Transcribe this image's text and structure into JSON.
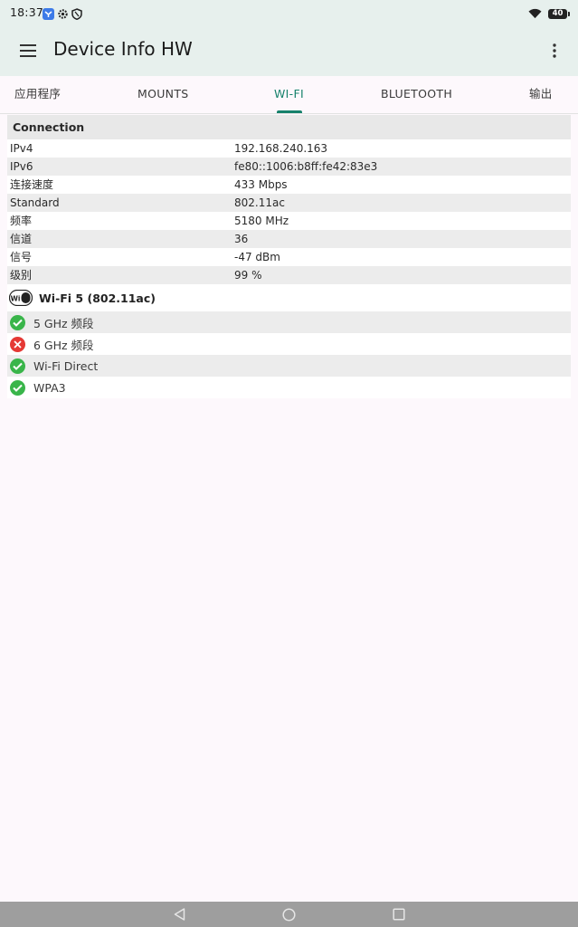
{
  "status_bar": {
    "time": "18:37",
    "battery": "40"
  },
  "app_bar": {
    "title": "Device Info HW"
  },
  "tabs": [
    {
      "label": "应用程序",
      "active": false
    },
    {
      "label": "MOUNTS",
      "active": false
    },
    {
      "label": "WI-FI",
      "active": true
    },
    {
      "label": "BLUETOOTH",
      "active": false
    },
    {
      "label": "输出",
      "active": false
    }
  ],
  "connection": {
    "header": "Connection",
    "rows": [
      {
        "key": "IPv4",
        "value": "192.168.240.163"
      },
      {
        "key": "IPv6",
        "value": "fe80::1006:b8ff:fe42:83e3"
      },
      {
        "key": "连接速度",
        "value": "433 Mbps"
      },
      {
        "key": "Standard",
        "value": "802.11ac"
      },
      {
        "key": "频率",
        "value": "5180 MHz"
      },
      {
        "key": "信道",
        "value": "36"
      },
      {
        "key": "信号",
        "value": "-47 dBm"
      },
      {
        "key": "级别",
        "value": "99 %"
      }
    ]
  },
  "wifi_standard": {
    "logo_text": "Wi Fi",
    "label": "Wi-Fi 5 (802.11ac)"
  },
  "features": [
    {
      "label": "5 GHz 频段",
      "supported": true
    },
    {
      "label": "6 GHz 频段",
      "supported": false
    },
    {
      "label": "Wi-Fi Direct",
      "supported": true
    },
    {
      "label": "WPA3",
      "supported": true
    }
  ],
  "colors": {
    "accent": "#16816b",
    "app_bar_bg": "#e7f0ed",
    "supported": "#39b54a",
    "unsupported": "#e53935"
  }
}
